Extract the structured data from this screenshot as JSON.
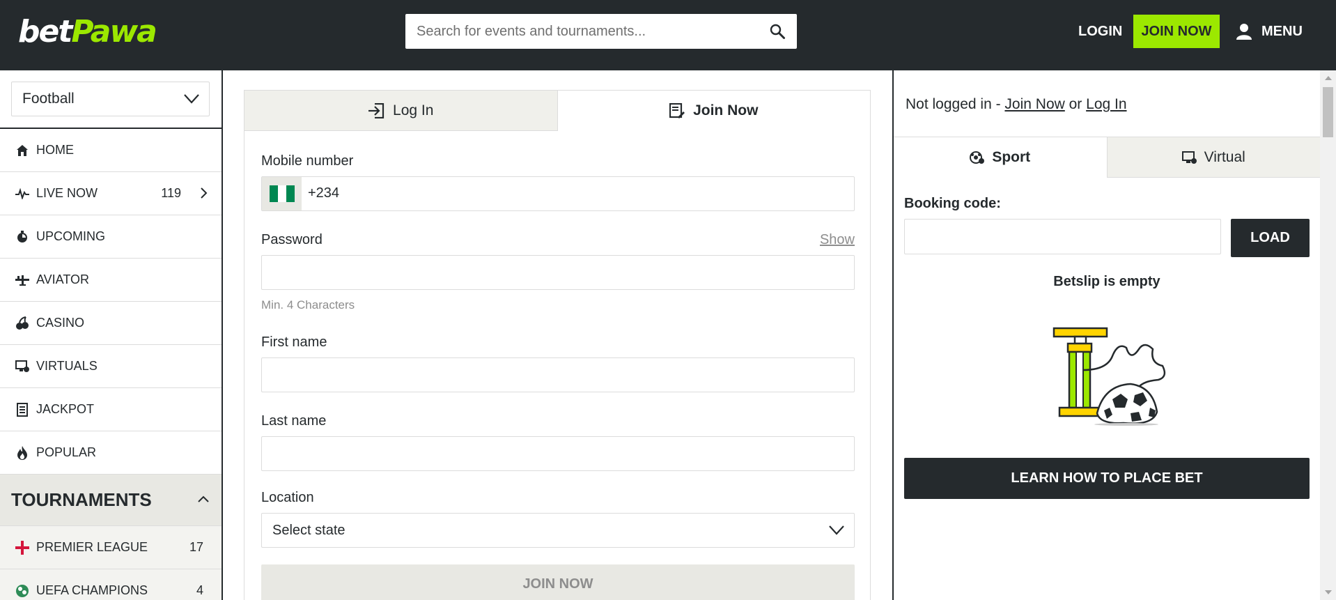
{
  "header": {
    "logo_part1": "bet",
    "logo_part2": "Pawa",
    "search_placeholder": "Search for events and tournaments...",
    "search_icon": "search-icon",
    "login_label": "LOGIN",
    "join_label": "JOIN NOW",
    "menu_label": "MENU",
    "menu_icon": "user-icon",
    "accent_color": "#9ce800",
    "bg_color": "#252a2d"
  },
  "sidebar": {
    "sport_selected": "Football",
    "nav_items": [
      {
        "label": "HOME",
        "icon": "home-icon"
      },
      {
        "label": "LIVE NOW",
        "icon": "pulse-icon",
        "count": "119"
      },
      {
        "label": "UPCOMING",
        "icon": "clock-icon"
      },
      {
        "label": "AVIATOR",
        "icon": "plane-icon"
      },
      {
        "label": "CASINO",
        "icon": "cherries-icon"
      },
      {
        "label": "VIRTUALS",
        "icon": "virtual-icon"
      },
      {
        "label": "JACKPOT",
        "icon": "ticket-icon"
      },
      {
        "label": "POPULAR",
        "icon": "flame-icon"
      }
    ],
    "tournaments_title": "TOURNAMENTS",
    "tournaments": [
      {
        "label": "PREMIER LEAGUE",
        "count": "17",
        "icon": "england-flag-icon"
      },
      {
        "label": "UEFA CHAMPIONS",
        "count": "4",
        "icon": "uefa-icon"
      }
    ]
  },
  "form": {
    "tab_login": "Log In",
    "tab_join": "Join Now",
    "mobile_label": "Mobile number",
    "mobile_prefix": "+234",
    "password_label": "Password",
    "show_label": "Show",
    "password_hint": "Min. 4 Characters",
    "first_name_label": "First name",
    "last_name_label": "Last name",
    "location_label": "Location",
    "location_placeholder": "Select state",
    "submit_label": "JOIN NOW"
  },
  "betslip": {
    "status_prefix": "Not logged in - ",
    "status_join": "Join Now",
    "status_or": " or ",
    "status_login": "Log In",
    "tab_sport": "Sport",
    "tab_virtual": "Virtual",
    "booking_label": "Booking code:",
    "load_label": "LOAD",
    "empty_text": "Betslip is empty",
    "learn_label": "LEARN HOW TO PLACE BET"
  }
}
